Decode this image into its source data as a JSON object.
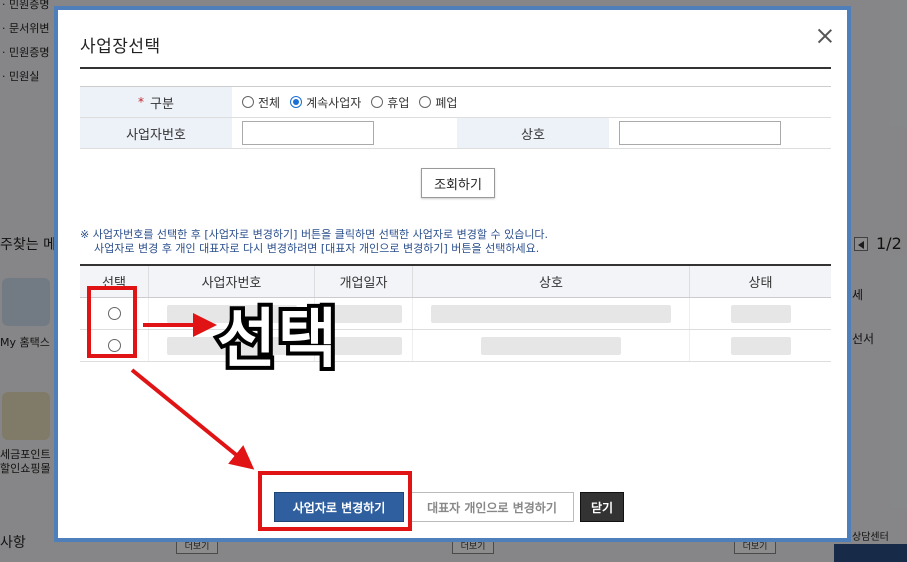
{
  "background": {
    "left_menu": [
      "민원증명",
      "문서위변",
      "민원증명",
      "민원실"
    ],
    "section_heading": "자주찾는 메",
    "section_heading_visible": "주찾는 메",
    "pager": "1/2",
    "shortcut_items": [
      {
        "label": "My 홈택스",
        "icon": "person-icon"
      },
      {
        "label_line1": "세금포인트",
        "label_line2": "할인쇼핑몰",
        "icon": "tax-bag-icon"
      }
    ],
    "right_items": [
      "세",
      "선서"
    ],
    "notice_heading": "사항",
    "more_label": "더보기",
    "right_footer": "상담센터"
  },
  "modal": {
    "title": "사업장선택",
    "close_icon": "close-icon",
    "form": {
      "type_label": "구분",
      "required_mark": "*",
      "type_options": [
        {
          "label": "전체",
          "checked": false
        },
        {
          "label": "계속사업자",
          "checked": true
        },
        {
          "label": "휴업",
          "checked": false
        },
        {
          "label": "폐업",
          "checked": false
        }
      ],
      "bizno_label": "사업자번호",
      "bizno_value": "",
      "name_label": "상호",
      "name_value": ""
    },
    "search_button": "조회하기",
    "notice_line1": "※ 사업자번호를 선택한 후 [사업자로 변경하기] 버튼을 클릭하면 선택한 사업자로 변경할 수 있습니다.",
    "notice_line2": "사업자로 변경 후 개인 대표자로 다시 변경하려면 [대표자 개인으로 변경하기] 버튼을 선택하세요.",
    "table": {
      "headers": [
        "선택",
        "사업자번호",
        "개업일자",
        "상호",
        "상태"
      ],
      "row_count": 2
    },
    "buttons": {
      "change_to_business": "사업자로 변경하기",
      "change_to_individual": "대표자 개인으로 변경하기",
      "close": "닫기"
    }
  },
  "annotation": {
    "label": "선택",
    "color": "#e01414"
  }
}
